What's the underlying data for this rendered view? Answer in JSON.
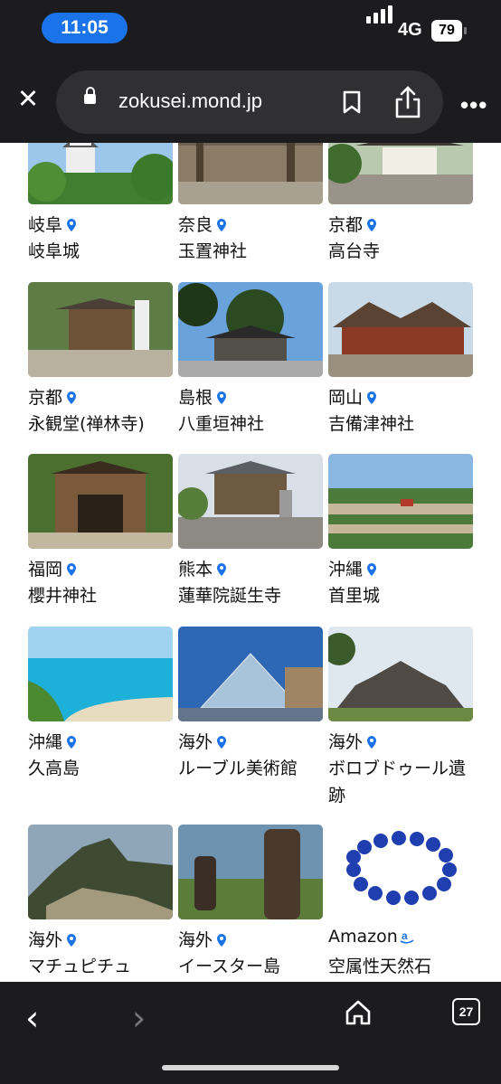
{
  "status_bar": {
    "time": "11:05",
    "network": "4G",
    "battery": "79"
  },
  "browser": {
    "url": "zokusei.mond.jp",
    "tab_count": "27"
  },
  "items": [
    {
      "region": "岐阜",
      "name": "岐阜城",
      "icon": "map-pin-icon"
    },
    {
      "region": "奈良",
      "name": "玉置神社",
      "icon": "map-pin-icon"
    },
    {
      "region": "京都",
      "name": "高台寺",
      "icon": "map-pin-icon"
    },
    {
      "region": "京都",
      "name": "永観堂(禅林寺)",
      "icon": "map-pin-icon"
    },
    {
      "region": "島根",
      "name": "八重垣神社",
      "icon": "map-pin-icon"
    },
    {
      "region": "岡山",
      "name": "吉備津神社",
      "icon": "map-pin-icon"
    },
    {
      "region": "福岡",
      "name": "櫻井神社",
      "icon": "map-pin-icon"
    },
    {
      "region": "熊本",
      "name": "蓮華院誕生寺",
      "icon": "map-pin-icon"
    },
    {
      "region": "沖縄",
      "name": "首里城",
      "icon": "map-pin-icon"
    },
    {
      "region": "沖縄",
      "name": "久高島",
      "icon": "map-pin-icon"
    },
    {
      "region": "海外",
      "name": "ルーブル美術館",
      "icon": "map-pin-icon"
    },
    {
      "region": "海外",
      "name": "ボロブドゥール遺跡",
      "icon": "map-pin-icon"
    },
    {
      "region": "海外",
      "name": "マチュピチュ",
      "icon": "map-pin-icon"
    },
    {
      "region": "海外",
      "name": "イースター島",
      "icon": "map-pin-icon"
    },
    {
      "region": "Amazon",
      "name": "空属性天然石",
      "icon": "amazon-icon"
    }
  ],
  "colors": {
    "accent": "#1a73e8",
    "chrome": "#1c1c1e",
    "urlbar": "#303033"
  }
}
